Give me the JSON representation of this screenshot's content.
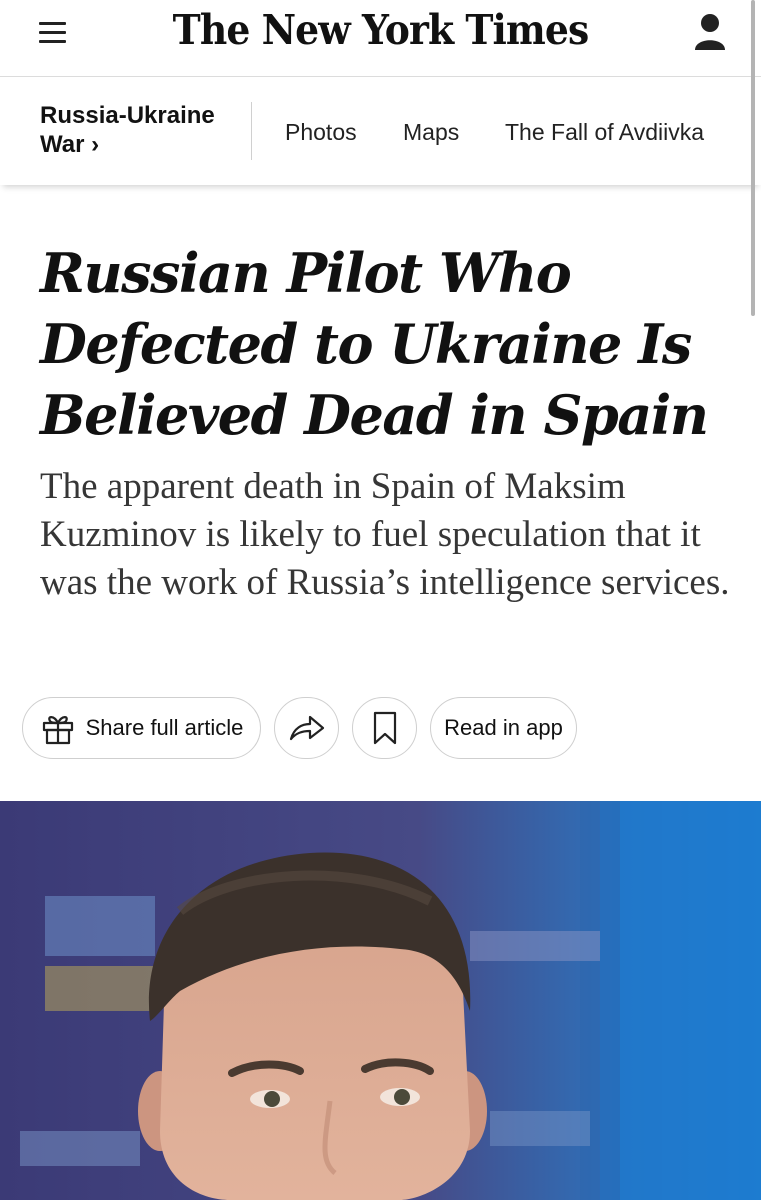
{
  "masthead": {
    "logo_text": "The New York Times",
    "menu_icon": "hamburger-menu-icon",
    "account_icon": "person-icon"
  },
  "section_nav": {
    "section_title_line1": "Russia-Ukraine",
    "section_title_line2": "War ›",
    "links": [
      "Photos",
      "Maps",
      "The Fall of Avdiivka"
    ]
  },
  "article": {
    "headline": "Russian Pilot Who Defected to Ukraine Is Believed Dead in Spain",
    "summary": "The apparent death in Spain of Maksim Kuzminov is likely to fuel speculation that it was the work of Russia’s intelligence services."
  },
  "actions": {
    "share_label": "Share full article",
    "share_icon": "gift-icon",
    "forward_icon": "share-arrow-icon",
    "bookmark_icon": "bookmark-icon",
    "read_in_app_label": "Read in app"
  },
  "colors": {
    "background": "#ffffff",
    "text": "#121212",
    "summary_text": "#363636",
    "border": "#cfcfcf",
    "photo_backdrop": "#3a3f7a",
    "flag_blue": "#1e6fc0"
  }
}
